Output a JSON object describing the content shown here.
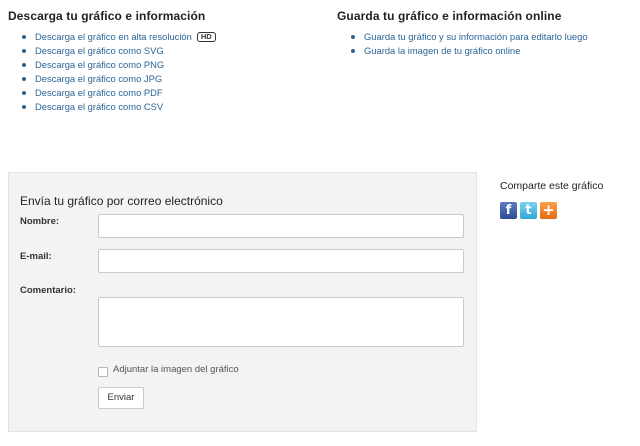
{
  "download": {
    "title": "Descarga tu gráfico e información",
    "items": [
      {
        "label": "Descarga el gráfico en alta resolución",
        "badge": "HD"
      },
      {
        "label": "Descarga el gráfico como SVG"
      },
      {
        "label": "Descarga el gráfico como PNG"
      },
      {
        "label": "Descarga el gráfico como JPG"
      },
      {
        "label": "Descarga el gráfico como PDF"
      },
      {
        "label": "Descarga el gráfico como CSV"
      }
    ]
  },
  "save": {
    "title": "Guarda tu gráfico e información online",
    "items": [
      {
        "label": "Guarda tu gráfico y su información para editarlo luego"
      },
      {
        "label": "Guarda la imagen de tu gráfico online"
      }
    ]
  },
  "email_form": {
    "title": "Envía tu gráfico por correo electrónico",
    "name_label": "Nombre:",
    "name_value": "",
    "email_label": "E-mail:",
    "email_value": "",
    "comment_label": "Comentario:",
    "comment_value": "",
    "attach_label": "Adjuntar la imagen del gráfico",
    "attach_checked": false,
    "send_label": "Enviar"
  },
  "share": {
    "title": "Comparte este gráfico",
    "icons": [
      {
        "name": "facebook-icon",
        "glyph": "f"
      },
      {
        "name": "twitter-icon",
        "glyph": "t"
      },
      {
        "name": "add-share-icon",
        "glyph": "+"
      }
    ]
  },
  "colors": {
    "link": "#2a6496",
    "panel_background": "#f3f3f3"
  }
}
